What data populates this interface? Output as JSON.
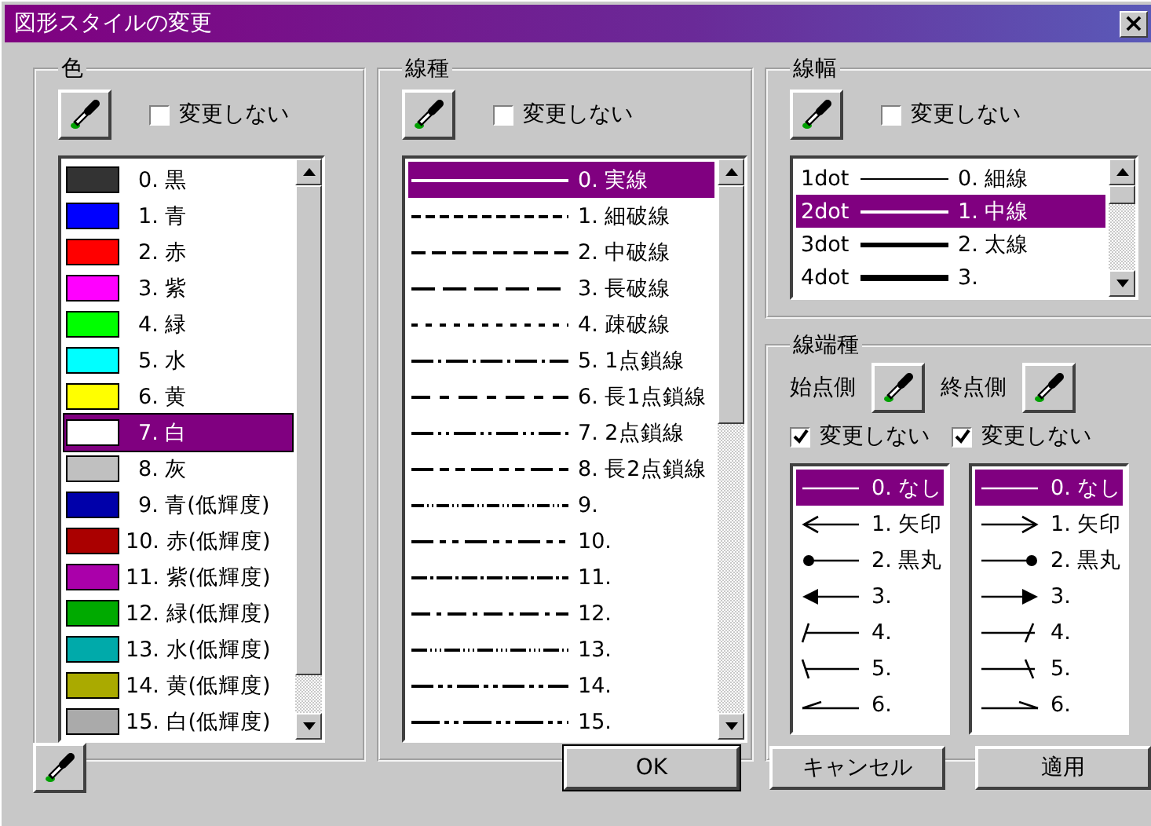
{
  "window": {
    "title": "図形スタイルの変更",
    "close": "×"
  },
  "color": {
    "title": "色",
    "no_change": {
      "label": "変更しない",
      "checked": false
    },
    "items": [
      {
        "label": "0. 黒",
        "color": "#333333",
        "selected": false
      },
      {
        "label": "1. 青",
        "color": "#0000ff",
        "selected": false
      },
      {
        "label": "2. 赤",
        "color": "#ff0000",
        "selected": false
      },
      {
        "label": "3. 紫",
        "color": "#ff00ff",
        "selected": false
      },
      {
        "label": "4. 緑",
        "color": "#00ff00",
        "selected": false
      },
      {
        "label": "5. 水",
        "color": "#00ffff",
        "selected": false
      },
      {
        "label": "6. 黄",
        "color": "#ffff00",
        "selected": false
      },
      {
        "label": "7. 白",
        "color": "#ffffff",
        "selected": true
      },
      {
        "label": "8. 灰",
        "color": "#c0c0c0",
        "selected": false
      },
      {
        "label": "9. 青(低輝度)",
        "color": "#0000aa",
        "selected": false
      },
      {
        "label": "10. 赤(低輝度)",
        "color": "#aa0000",
        "selected": false
      },
      {
        "label": "11. 紫(低輝度)",
        "color": "#aa00aa",
        "selected": false
      },
      {
        "label": "12. 緑(低輝度)",
        "color": "#00aa00",
        "selected": false
      },
      {
        "label": "13. 水(低輝度)",
        "color": "#00aaaa",
        "selected": false
      },
      {
        "label": "14. 黄(低輝度)",
        "color": "#aaaa00",
        "selected": false
      },
      {
        "label": "15. 白(低輝度)",
        "color": "#aaaaaa",
        "selected": false
      }
    ]
  },
  "line_type": {
    "title": "線種",
    "no_change": {
      "label": "変更しない",
      "checked": false
    },
    "items": [
      {
        "label": "0. 実線",
        "kind": "solid",
        "selected": true
      },
      {
        "label": "1. 細破線",
        "kind": "fine",
        "selected": false
      },
      {
        "label": "2. 中破線",
        "kind": "medium",
        "selected": false
      },
      {
        "label": "3. 長破線",
        "kind": "long",
        "selected": false
      },
      {
        "label": "4. 疎破線",
        "kind": "sparse",
        "selected": false
      },
      {
        "label": "5. 1点鎖線",
        "kind": "dot1",
        "selected": false
      },
      {
        "label": "6. 長1点鎖線",
        "kind": "long1",
        "selected": false
      },
      {
        "label": "7. 2点鎖線",
        "kind": "dot2",
        "selected": false
      },
      {
        "label": "8. 長2点鎖線",
        "kind": "long2",
        "selected": false
      },
      {
        "label": "9.",
        "kind": "dense",
        "selected": false
      },
      {
        "label": "10.",
        "kind": "triple",
        "selected": false
      },
      {
        "label": "11.",
        "kind": "mixed",
        "selected": false
      },
      {
        "label": "12.",
        "kind": "alternate",
        "selected": false
      },
      {
        "label": "13.",
        "kind": "fine2",
        "selected": false
      },
      {
        "label": "14.",
        "kind": "chain",
        "selected": false
      },
      {
        "label": "15.",
        "kind": "long3",
        "selected": false
      }
    ]
  },
  "line_width": {
    "title": "線幅",
    "no_change": {
      "label": "変更しない",
      "checked": false
    },
    "items": [
      {
        "unit": "1dot",
        "label": "0. 細線",
        "selected": false
      },
      {
        "unit": "2dot",
        "label": "1. 中線",
        "selected": true
      },
      {
        "unit": "3dot",
        "label": "2. 太線",
        "selected": false
      },
      {
        "unit": "4dot",
        "label": "3.",
        "selected": false
      }
    ]
  },
  "line_end": {
    "title": "線端種",
    "sides": [
      {
        "label": "始点側",
        "no_change": {
          "label": "変更しない",
          "checked": true
        },
        "items": [
          {
            "label": "0. なし",
            "kind": "none",
            "selected": true
          },
          {
            "label": "1. 矢印",
            "kind": "open-arrow",
            "selected": false
          },
          {
            "label": "2. 黒丸",
            "kind": "dot",
            "selected": false
          },
          {
            "label": "3.",
            "kind": "filled-arrow",
            "selected": false
          },
          {
            "label": "4.",
            "kind": "slash",
            "selected": false
          },
          {
            "label": "5.",
            "kind": "backslash",
            "selected": false
          },
          {
            "label": "6.",
            "kind": "half-arrow",
            "selected": false
          }
        ]
      },
      {
        "label": "終点側",
        "no_change": {
          "label": "変更しない",
          "checked": true
        },
        "items": [
          {
            "label": "0. なし",
            "kind": "none",
            "selected": true
          },
          {
            "label": "1. 矢印",
            "kind": "open-arrow",
            "selected": false
          },
          {
            "label": "2. 黒丸",
            "kind": "dot",
            "selected": false
          },
          {
            "label": "3.",
            "kind": "filled-arrow",
            "selected": false
          },
          {
            "label": "4.",
            "kind": "slash",
            "selected": false
          },
          {
            "label": "5.",
            "kind": "backslash",
            "selected": false
          },
          {
            "label": "6.",
            "kind": "half-arrow",
            "selected": false
          }
        ]
      }
    ]
  },
  "buttons": [
    {
      "label": "OK",
      "default": true
    },
    {
      "label": "キャンセル",
      "default": false
    },
    {
      "label": "適用",
      "default": false
    }
  ]
}
